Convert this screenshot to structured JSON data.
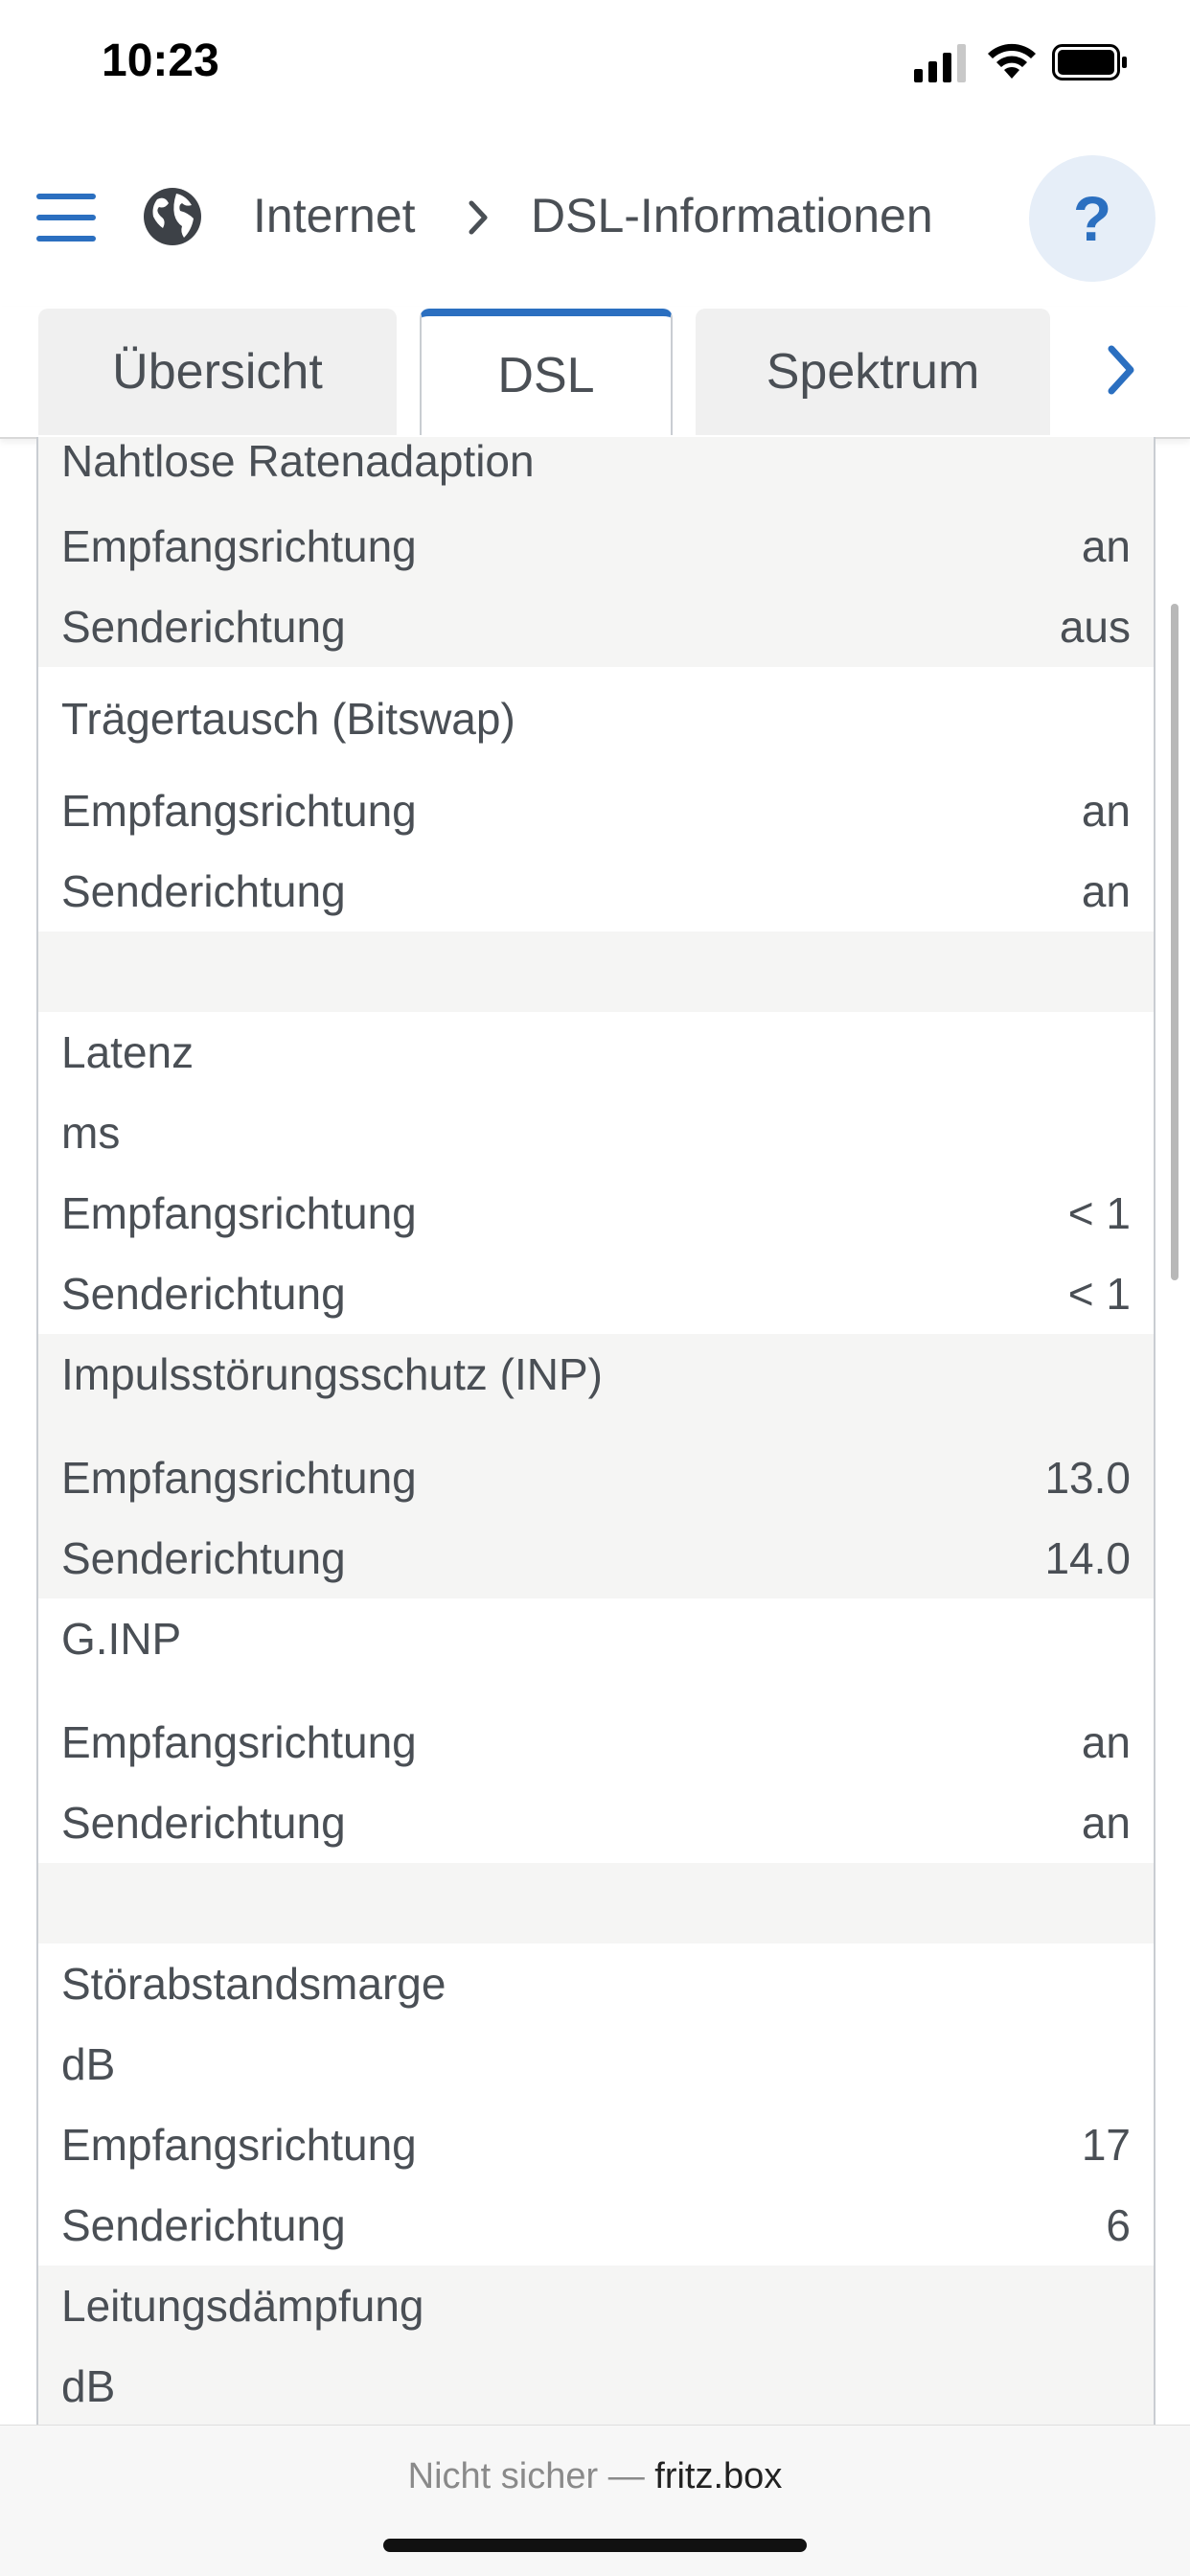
{
  "status_bar": {
    "time": "10:23"
  },
  "breadcrumb": {
    "section": "Internet",
    "page": "DSL-Informationen"
  },
  "help": {
    "label": "?"
  },
  "tabs": [
    {
      "label": "Übersicht",
      "selected": false
    },
    {
      "label": "DSL",
      "selected": true
    },
    {
      "label": "Spektrum",
      "selected": false
    }
  ],
  "groups": [
    {
      "title": "Nahtlose Ratenadaption",
      "rows": [
        {
          "label": "Empfangsrichtung",
          "value": "an"
        },
        {
          "label": "Senderichtung",
          "value": "aus"
        }
      ]
    },
    {
      "title": "Trägertausch (Bitswap)",
      "rows": [
        {
          "label": "Empfangsrichtung",
          "value": "an"
        },
        {
          "label": "Senderichtung",
          "value": "an"
        }
      ]
    },
    {
      "title": "Latenz",
      "unit": "ms",
      "rows": [
        {
          "label": "Empfangsrichtung",
          "value": "< 1"
        },
        {
          "label": "Senderichtung",
          "value": "< 1"
        }
      ]
    },
    {
      "title": "Impulsstörungsschutz (INP)",
      "rows": [
        {
          "label": "Empfangsrichtung",
          "value": "13.0"
        },
        {
          "label": "Senderichtung",
          "value": "14.0"
        }
      ]
    },
    {
      "title": "G.INP",
      "rows": [
        {
          "label": "Empfangsrichtung",
          "value": "an"
        },
        {
          "label": "Senderichtung",
          "value": "an"
        }
      ]
    },
    {
      "title": "Störabstandsmarge",
      "unit": "dB",
      "rows": [
        {
          "label": "Empfangsrichtung",
          "value": "17"
        },
        {
          "label": "Senderichtung",
          "value": "6"
        }
      ]
    },
    {
      "title": "Leitungsdämpfung",
      "unit": "dB"
    }
  ],
  "browser": {
    "prefix": "Nicht sicher —",
    "host": "fritz.box"
  },
  "colors": {
    "accent": "#2b6fc0",
    "text": "#4a4f55",
    "alt_row": "#f5f5f4"
  }
}
